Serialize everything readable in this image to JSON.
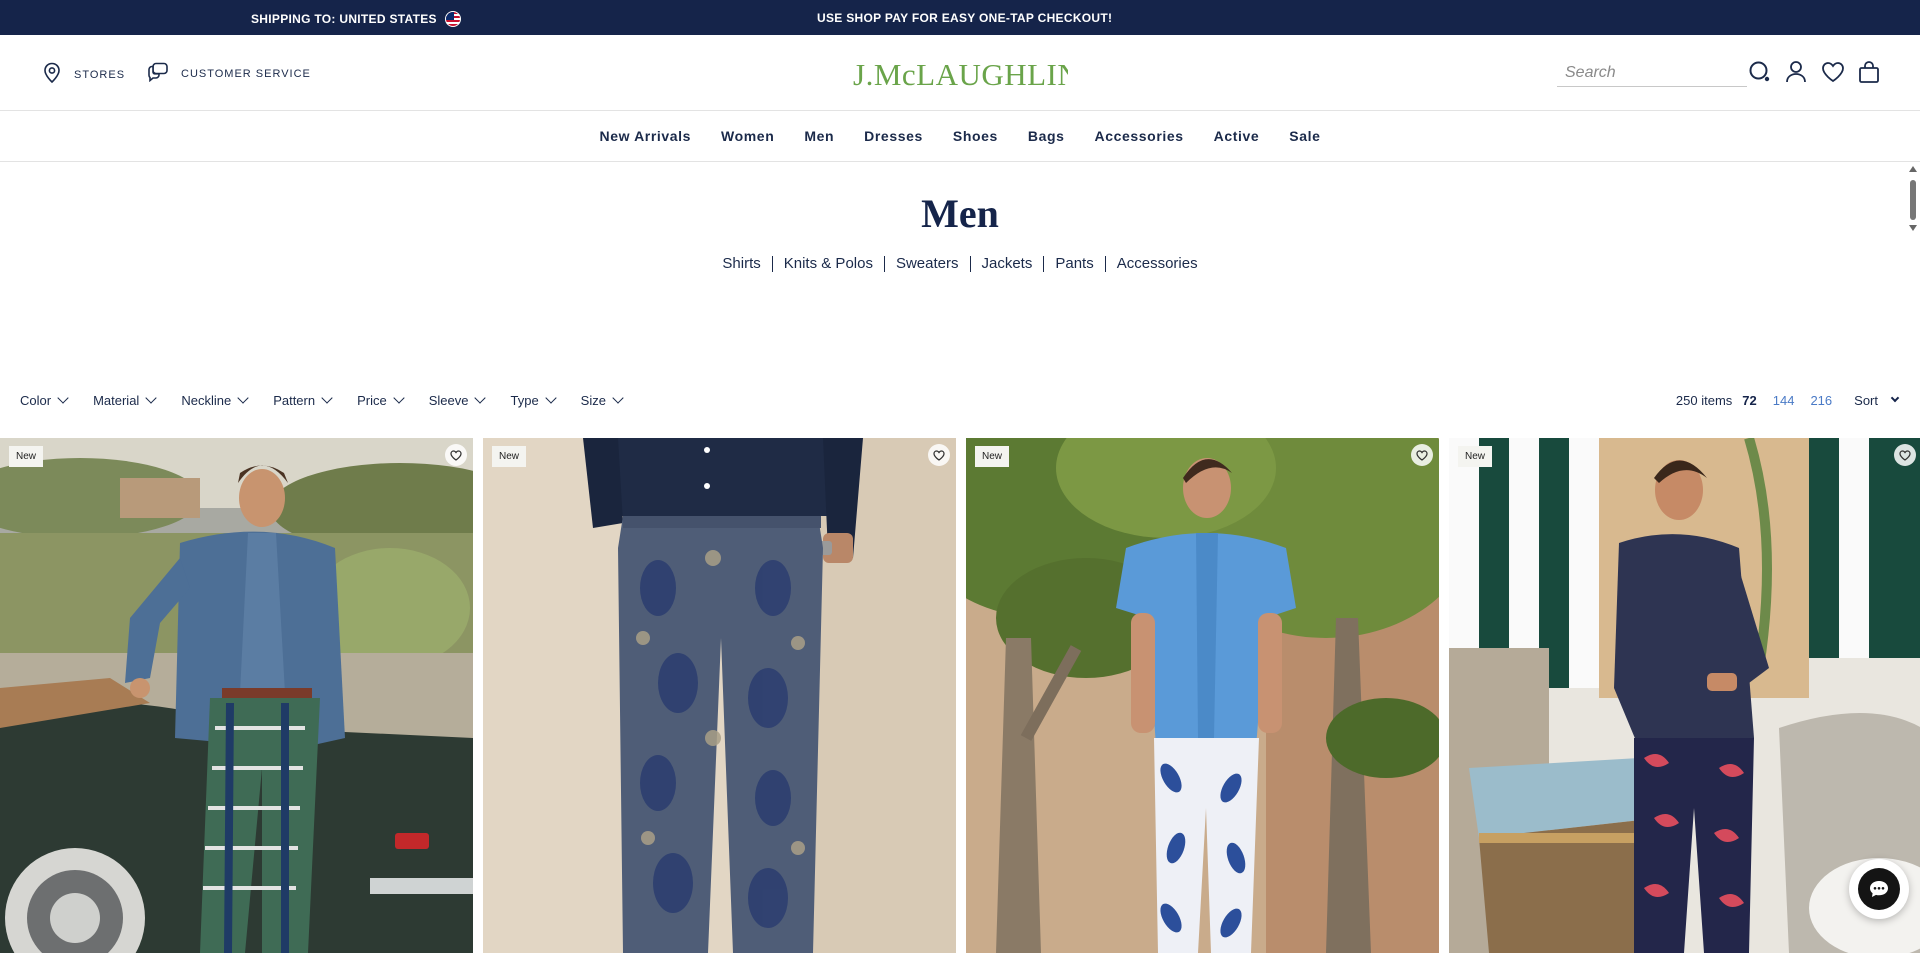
{
  "banner": {
    "shipping_label": "SHIPPING TO: UNITED STATES",
    "promo": "USE SHOP PAY FOR EASY ONE-TAP CHECKOUT!"
  },
  "header": {
    "stores_label": "STORES",
    "customer_service_label": "CUSTOMER SERVICE",
    "logo_text": "J.McLAUGHLIN",
    "search_placeholder": "Search"
  },
  "nav": {
    "items": [
      "New Arrivals",
      "Women",
      "Men",
      "Dresses",
      "Shoes",
      "Bags",
      "Accessories",
      "Active",
      "Sale"
    ]
  },
  "page": {
    "title": "Men",
    "subcategories": [
      "Shirts",
      "Knits & Polos",
      "Sweaters",
      "Jackets",
      "Pants",
      "Accessories"
    ]
  },
  "filters": [
    "Color",
    "Material",
    "Neckline",
    "Pattern",
    "Price",
    "Sleeve",
    "Type",
    "Size"
  ],
  "results": {
    "count_label": "250 items",
    "per_page": [
      "72",
      "144",
      "216"
    ],
    "active_per_page": "72",
    "sort_label": "Sort"
  },
  "products": [
    {
      "badge": "New"
    },
    {
      "badge": "New"
    },
    {
      "badge": "New"
    },
    {
      "badge": "New"
    }
  ],
  "colors": {
    "banner_bg": "#15244a",
    "logo": "#6aa44a",
    "text": "#1b2a4a",
    "link_blue": "#4a7ac6"
  }
}
